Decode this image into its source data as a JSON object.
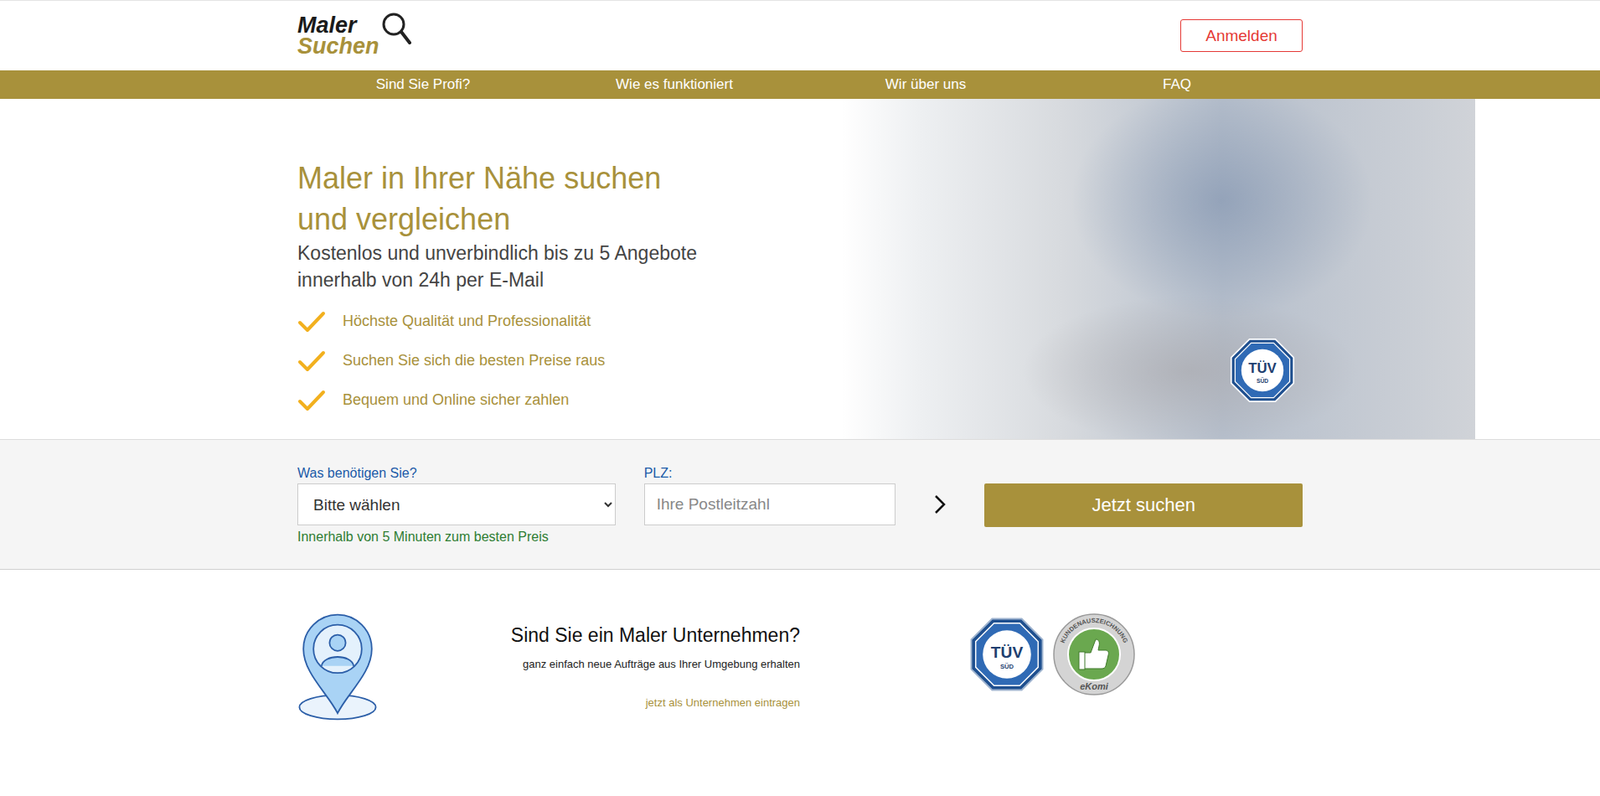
{
  "header": {
    "logo": {
      "line1": "Maler",
      "line2": "Suchen"
    },
    "login_button": "Anmelden"
  },
  "nav": {
    "items": [
      "Sind Sie Profi?",
      "Wie es funktioniert",
      "Wir über uns",
      "FAQ"
    ]
  },
  "hero": {
    "title_lines": [
      "Maler in Ihrer Nähe suchen",
      "und vergleichen"
    ],
    "subtitle_lines": [
      "Kostenlos und unverbindlich bis zu 5 Angebote",
      "innerhalb von 24h per E-Mail"
    ],
    "features": [
      "Höchste Qualität und Professionalität",
      "Suchen Sie sich die besten Preise raus",
      "Bequem und Online sicher zahlen"
    ],
    "photo_badge": {
      "top": "TÜV",
      "bottom": "SÜD"
    }
  },
  "search": {
    "service_label": "Was benötigen Sie?",
    "service_value": "Bitte wählen",
    "hint": "Innerhalb von 5 Minuten zum besten Preis",
    "zip_label": "PLZ:",
    "zip_placeholder": "Ihre Postleitzahl",
    "submit": "Jetzt suchen"
  },
  "business": {
    "title": "Sind Sie ein Maler Unternehmen?",
    "subtitle": "ganz einfach neue Aufträge aus Ihrer Umgebung erhalten",
    "link": "jetzt als Unternehmen eintragen"
  },
  "badges": [
    {
      "kind": "tuv",
      "top": "TÜV",
      "bottom": "SÜD"
    },
    {
      "kind": "ekomi",
      "ring": "KUNDENAUSZEICHNUNG",
      "name": "eKomi"
    }
  ]
}
